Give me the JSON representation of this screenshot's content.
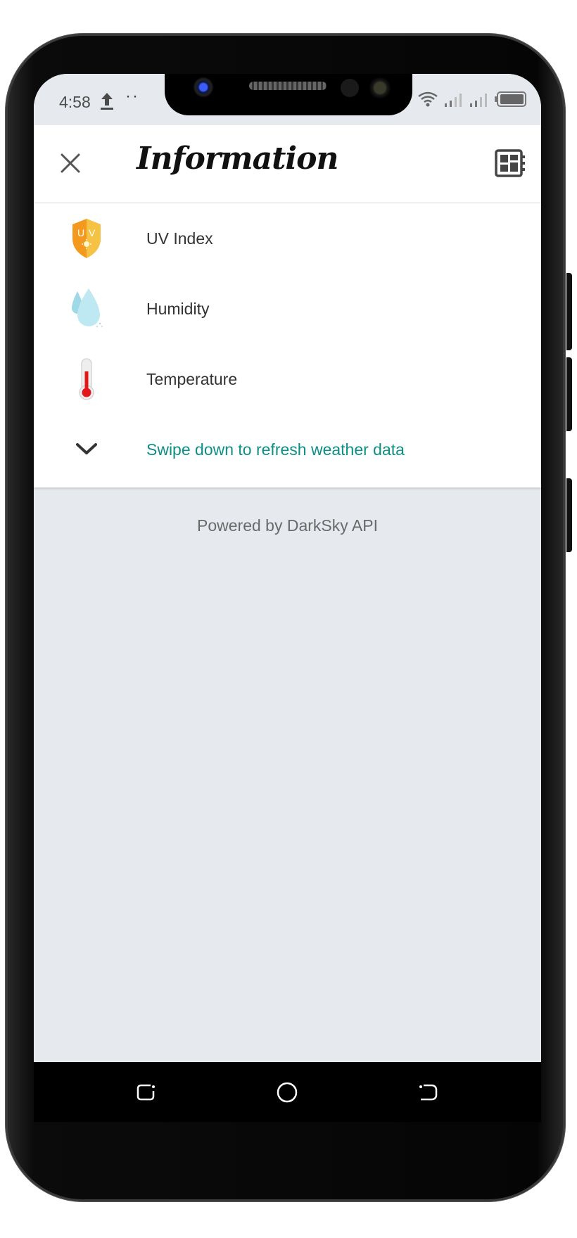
{
  "status_bar": {
    "time": "4:58",
    "left_icons": [
      "upload-icon",
      "more-dots-icon"
    ],
    "right_icons": [
      "wifi-icon",
      "signal-icon",
      "signal-icon",
      "battery-icon"
    ]
  },
  "app_bar": {
    "title": "Information",
    "close_icon": "close-icon",
    "action_icon": "dashboard-icon"
  },
  "info_list": {
    "items": [
      {
        "label": "UV Index",
        "icon": "uv-shield-icon"
      },
      {
        "label": "Humidity",
        "icon": "water-drops-icon"
      },
      {
        "label": "Temperature",
        "icon": "thermometer-icon"
      }
    ],
    "refresh_hint": {
      "label": "Swipe down to refresh weather data",
      "icon": "chevron-down-icon"
    }
  },
  "footer": {
    "text": "Powered by DarkSky API"
  },
  "nav_bar": {
    "buttons": [
      "recent-apps-icon",
      "home-icon",
      "back-icon"
    ]
  },
  "colors": {
    "accent": "#0e8f86",
    "background": "#e6eaee",
    "card": "#ffffff",
    "uv_orange": "#f39a1e",
    "thermometer_red": "#e3161a",
    "drop_blue": "#bfe9f2"
  }
}
